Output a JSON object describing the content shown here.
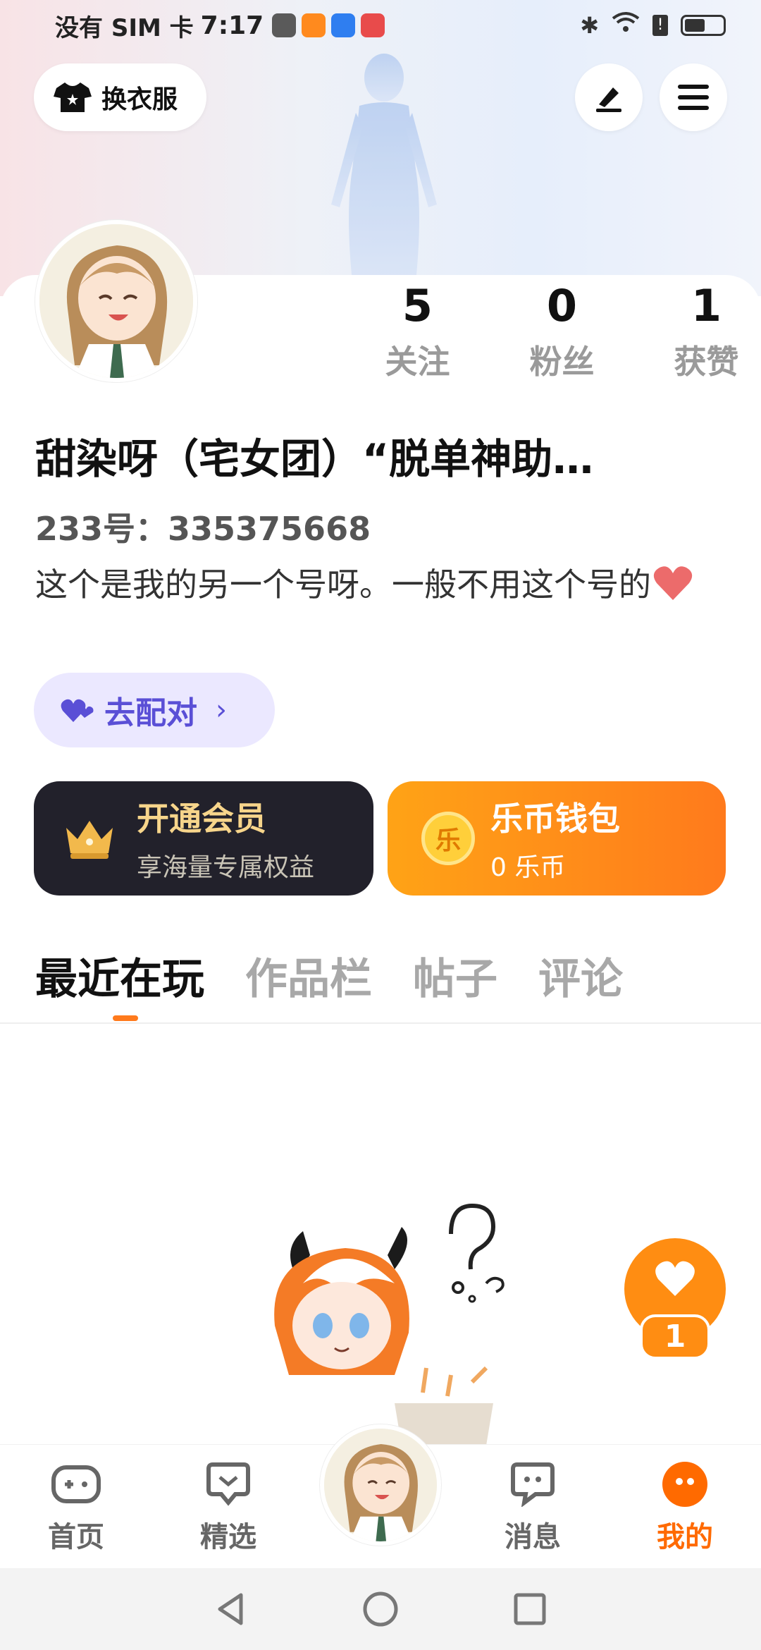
{
  "status_bar": {
    "carrier": "没有 SIM 卡",
    "time": "7:17",
    "app_icons": [
      "#5a5a5a",
      "#ff8a1e",
      "#2f7ef0",
      "#e84b4b"
    ]
  },
  "header": {
    "outfit_label": "换衣服",
    "edit_icon": "pen-icon",
    "menu_icon": "menu-icon"
  },
  "profile": {
    "stats": [
      {
        "value": "5",
        "label": "关注"
      },
      {
        "value": "0",
        "label": "粉丝"
      },
      {
        "value": "1",
        "label": "获赞"
      }
    ],
    "name": "甜染呀（宅女团）“脱单神助…",
    "uid": "233号：335375668",
    "bio": "这个是我的另一个号呀。一般不用这个号的",
    "match_label": "去配对",
    "match_chevron": "›"
  },
  "cards": {
    "vip_title": "开通会员",
    "vip_sub": "享海量专属权益",
    "wallet_title": "乐币钱包",
    "wallet_sub": "0 乐币",
    "coin_glyph": "乐"
  },
  "tabs": [
    "最近在玩",
    "作品栏",
    "帖子",
    "评论"
  ],
  "like_fab": {
    "count": "1"
  },
  "bottom_nav": [
    {
      "label": "首页",
      "icon": "gamepad-icon"
    },
    {
      "label": "精选",
      "icon": "heart-chat-icon"
    },
    {
      "label": "",
      "icon": "avatar"
    },
    {
      "label": "消息",
      "icon": "message-icon"
    },
    {
      "label": "我的",
      "icon": "profile-icon"
    }
  ],
  "colors": {
    "accent_orange": "#ff7a1c",
    "match_purple": "#5a4fd6",
    "vip_gold": "#f7d58b"
  }
}
